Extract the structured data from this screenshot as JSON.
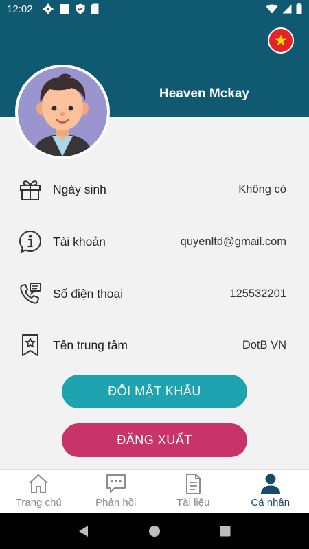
{
  "status_bar": {
    "time": "12:02"
  },
  "profile": {
    "name": "Heaven Mckay"
  },
  "info": [
    {
      "label": "Ngày sinh",
      "value": "Không có",
      "icon": "gift-icon"
    },
    {
      "label": "Tài khoản",
      "value": "quyenltd@gmail.com",
      "icon": "info-icon"
    },
    {
      "label": "Số điện thoại",
      "value": "125532201",
      "icon": "phone-icon"
    },
    {
      "label": "Tên trung tâm",
      "value": "DotB VN",
      "icon": "bookmark-star-icon"
    }
  ],
  "buttons": {
    "change_password": "ĐỔI MẬT KHẨU",
    "logout": "ĐĂNG XUẤT"
  },
  "nav": [
    {
      "label": "Trang chủ",
      "icon": "home-icon",
      "active": false
    },
    {
      "label": "Phản hồi",
      "icon": "chat-icon",
      "active": false
    },
    {
      "label": "Tài liệu",
      "icon": "document-icon",
      "active": false
    },
    {
      "label": "Cá nhân",
      "icon": "person-icon",
      "active": true
    }
  ],
  "colors": {
    "header": "#0f5a70",
    "button_primary": "#1ea3b1",
    "button_logout": "#c93468",
    "nav_active": "#184a6b"
  }
}
